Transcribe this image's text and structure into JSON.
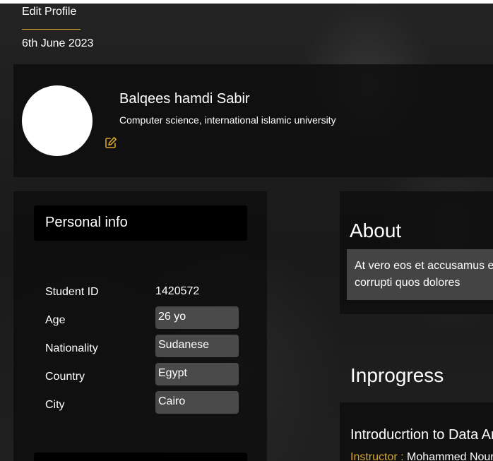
{
  "header": {
    "title": "Edit Profile",
    "date": "6th June 2023",
    "accent_color": "#d6a52c"
  },
  "profile": {
    "name": "Balqees hamdi Sabir",
    "subtitle": "Computer science, international islamic university",
    "edit_icon": "edit-icon"
  },
  "personal_info": {
    "title": "Personal info",
    "student_id_label": "Student ID",
    "student_id_value": "1420572",
    "age_label": "Age",
    "age_value": "26 yo",
    "nationality_label": "Nationality",
    "nationality_value": "Sudanese",
    "country_label": "Country",
    "country_value": "Egypt",
    "city_label": "City",
    "city_value": "Cairo"
  },
  "about": {
    "title": "About",
    "text_line1": "At vero eos et accusamus e",
    "text_line2": "corrupti quos dolores"
  },
  "inprogress": {
    "title": "Inprogress",
    "course": {
      "title": "Introducrtion to Data Ar",
      "instructor_label": "Instructor :",
      "instructor_name": " Mohammed Nour"
    }
  }
}
